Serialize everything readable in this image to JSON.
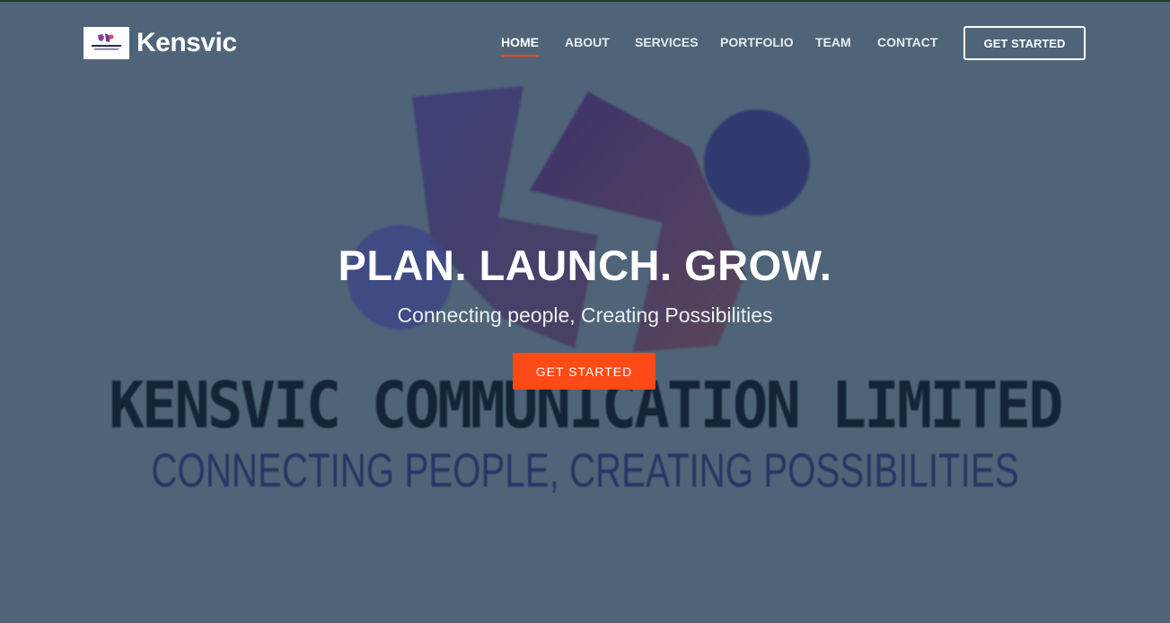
{
  "brand": {
    "name": "Kensvic",
    "logo_icon": "kensvic-logo-icon"
  },
  "nav": {
    "items": [
      {
        "label": "HOME",
        "active": true
      },
      {
        "label": "ABOUT",
        "active": false
      },
      {
        "label": "SERVICES",
        "active": false
      },
      {
        "label": "PORTFOLIO",
        "active": false
      },
      {
        "label": "TEAM",
        "active": false
      },
      {
        "label": "CONTACT",
        "active": false
      }
    ],
    "cta_label": "GET STARTED"
  },
  "hero": {
    "title": "PLAN. LAUNCH. GROW.",
    "subtitle": "Connecting people, Creating Possibilities",
    "cta_label": "GET STARTED",
    "background": {
      "company_name": "KENSVIC COMMUNICATION LIMITED",
      "tagline": "CONNECTING PEOPLE, CREATING POSSIBILITIES"
    }
  },
  "colors": {
    "overlay": "#4f6478",
    "accent": "#ff4a17",
    "text": "#ffffff"
  }
}
